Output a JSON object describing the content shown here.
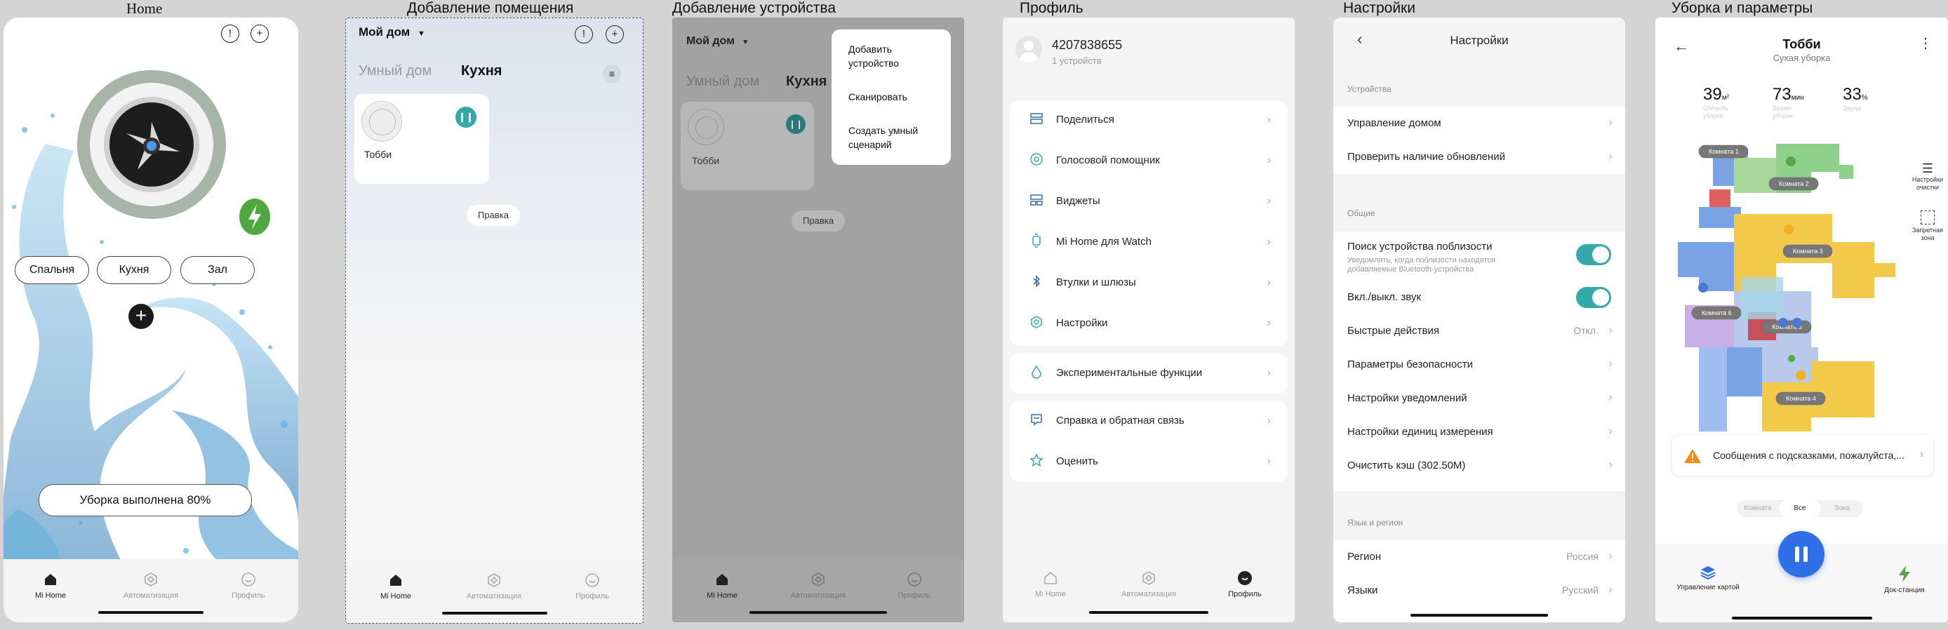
{
  "captions": {
    "home": "Home",
    "add_room": "Добавление помещения",
    "add_device": "Добавление устройства",
    "profile": "Профиль",
    "settings": "Настройки",
    "cleaning": "Уборка и параметры"
  },
  "nav": {
    "home": "Mi Home",
    "automation": "Автоматизация",
    "profile": "Профиль"
  },
  "home": {
    "rooms": [
      "Спальня",
      "Кухня",
      "Зал"
    ],
    "status": "Уборка выполнена 80%",
    "progress": 0.8
  },
  "add_room": {
    "home_name": "Мой дом",
    "tabs": [
      "Умный дом",
      "Кухня"
    ],
    "device_name": "Тобби",
    "edit_button": "Правка"
  },
  "add_device": {
    "home_name": "Мой дом",
    "tabs": [
      "Умный дом",
      "Кухня"
    ],
    "device_name": "Тобби",
    "edit_button": "Правка",
    "menu": [
      "Добавить устройство",
      "Сканировать",
      "Создать умный сценарий"
    ]
  },
  "profile": {
    "user_id": "4207838655",
    "devices_count": "1 устройств",
    "group1": [
      {
        "label": "Поделиться",
        "icon": "share-icon"
      },
      {
        "label": "Голосовой помощник",
        "icon": "voice-assistant-icon"
      },
      {
        "label": "Виджеты",
        "icon": "widgets-icon"
      },
      {
        "label": "Mi Home для Watch",
        "icon": "watch-icon"
      },
      {
        "label": "Втулки и шлюзы",
        "icon": "bluetooth-icon"
      },
      {
        "label": "Настройки",
        "icon": "settings-icon"
      }
    ],
    "experimental": "Экспериментальные функции",
    "help": "Справка и обратная связь",
    "rate": "Оценить"
  },
  "settings": {
    "title": "Настройки",
    "section_devices": "Устройства",
    "manage_home": "Управление домом",
    "check_updates": "Проверить наличие обновлений",
    "section_general": "Общие",
    "nearby_title": "Поиск устройства поблизости",
    "nearby_desc": "Уведомлять, когда поблизости находятся добавляемые Bluetooth-устройства",
    "sound": "Вкл./выкл. звук",
    "quick_actions": "Быстрые действия",
    "quick_actions_value": "Откл.",
    "security": "Параметры безопасности",
    "notifications": "Настройки уведомлений",
    "units": "Настройки единиц измерения",
    "clear_cache": "Очистить кэш (302.50M)",
    "section_lang": "Язык и регион",
    "region": "Регион",
    "region_value": "Россия",
    "languages": "Языки",
    "languages_value": "Русский"
  },
  "cleaning": {
    "title": "Тобби",
    "subtitle": "Сухая уборка",
    "stats": [
      {
        "value": "39",
        "unit": "м²",
        "label": "Область уборки"
      },
      {
        "value": "73",
        "unit": "мин",
        "label": "Время уборки"
      },
      {
        "value": "33",
        "unit": "%",
        "label": "Заряд"
      }
    ],
    "rooms": [
      "Комната 1",
      "Комната 2",
      "Комната 3",
      "Комната 5",
      "Комната 6",
      "Комната 4"
    ],
    "side_tools": [
      "Настройки очистки",
      "Запретная зона"
    ],
    "hint": "Сообщения с подсказками, пожалуйста,...",
    "modes": [
      "Комната",
      "Все",
      "Зона"
    ],
    "map_manage": "Управление картой",
    "dock": "Док-станция"
  },
  "colors": {
    "teal": "#35a8a8",
    "blue": "#2f6fe8",
    "green": "#5aa544",
    "orange": "#f08c1a"
  }
}
